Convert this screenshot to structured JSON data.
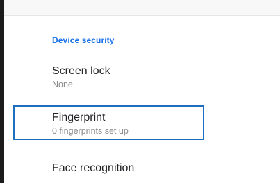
{
  "section": {
    "title": "Device security"
  },
  "items": [
    {
      "title": "Screen lock",
      "summary": "None"
    },
    {
      "title": "Fingerprint",
      "summary": "0 fingerprints set up"
    },
    {
      "title": "Face recognition"
    }
  ],
  "colors": {
    "accent": "#1a73e8",
    "focus_outline": "#1f6fc0",
    "background": "#ffffff",
    "frame": "#1c1c1c"
  }
}
